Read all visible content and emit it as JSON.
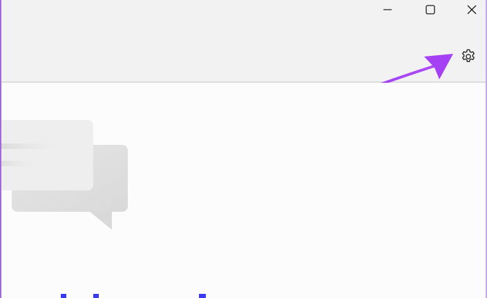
{
  "window": {
    "minimize_icon": "minimize-icon",
    "maximize_icon": "maximize-icon",
    "close_icon": "close-icon"
  },
  "toolbar": {
    "settings_icon": "gear-icon"
  },
  "annotation": {
    "arrow_color": "#a640f4",
    "points_to": "settings"
  },
  "illustration": {
    "name": "empty-state-chat-bubbles"
  },
  "colors": {
    "titlebar_bg": "#f2f2f2",
    "content_bg": "#fcfcfc",
    "accent_purple": "#a640f4"
  }
}
